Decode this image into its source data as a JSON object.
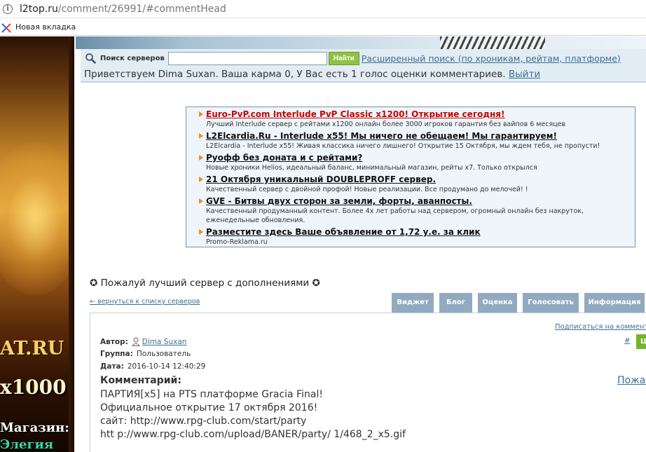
{
  "browser": {
    "url_host": "l2top.ru",
    "url_path": "/comment/26991/#commentHead",
    "bookmark_label": "Новая вкладка"
  },
  "banner": {
    "line1": "AT.RU",
    "line2": "x1000",
    "line3": "Магазин:",
    "line4": "Элегия"
  },
  "search": {
    "label": "Поиск серверов",
    "value": "",
    "button": "Найти",
    "advanced_link": "Расширенный поиск (по хроникам, рейтам, платформе)"
  },
  "greeting": {
    "prefix": "Приветствуем Dima Suxan. Ваша карма ",
    "karma": "0",
    "suffix": ", У Вас есть 1 голос оценки комментариев. ",
    "logout": "Выйти"
  },
  "ads": [
    {
      "title": "Euro-PvP.com Interlude PvP Classic x1200! Открытие сегодня!",
      "desc": "Лучший Interlude сервер с рейтами x1200 онлайн более 3000 игроков гарантия без вайпов 6 месяцев",
      "red": true
    },
    {
      "title": "L2Elcardia.Ru - Interlude x55! Мы ничего не обещаем! Мы гарантируем!",
      "desc": "L2Elcardia - Interlude x55! Живая классика ничего лишнего! Открытие 15 Октября, мы ждем тебя, не пропусти!"
    },
    {
      "title": "Руофф без доната и с рейтами?",
      "desc": "Новые хроники Helios, идеальный баланс, минимальный магазин, рейты x7. Только открылся"
    },
    {
      "title": "21 Октября уникальный DOUBLEPROFF сервер.",
      "desc": "Качественный сервер с двойной профой! Новые реализации. Все продумано до мелочей! !"
    },
    {
      "title": "GVE - Битвы двух сторон за земли, форты, аванпосты.",
      "desc": "Качественный продуманный контент. Более 4х лет работы над сервером, огромный онлайн без накруток, еженедельные обновления."
    },
    {
      "title": "Разместите здесь Ваше объявление от 1,72 у.е. за клик",
      "desc": "Promo-Reklama.ru"
    }
  ],
  "server": {
    "title": "✪ Пожалуй лучший сервер с дополнениями ✪",
    "back_link": "← вернуться к списку серверов"
  },
  "tabs": [
    "Виджет",
    "Блог",
    "Оценка",
    "Голосовать",
    "Информация"
  ],
  "comment": {
    "subscribe": "Подписаться на коммента",
    "hash": "#",
    "green_btn": "Ц",
    "author_label": "Автор:",
    "author": "Dima Suxan",
    "group_label": "Группа:",
    "group": "Пользователь",
    "date_label": "Дата:",
    "date": "2016-10-14 12:40:29",
    "heading": "Комментарий:",
    "complain": "Пожал",
    "lines": [
      "ПАРТИЯ[x5] на PTS платформе Gracia Final!",
      "Официальное открытие 17 октября 2016!",
      "сайт: http://www.rpg-club.com/start/party",
      "htt p://www.rpg-club.com/upload/BANER/party/ 1/468_2_x5.gif"
    ]
  },
  "colors": {
    "link": "#3c6f94",
    "tab_bg": "#92aac0",
    "search_button": "#8fc343",
    "ad_arrow": "#f08a1e",
    "ad_red_title": "#cc0000"
  }
}
